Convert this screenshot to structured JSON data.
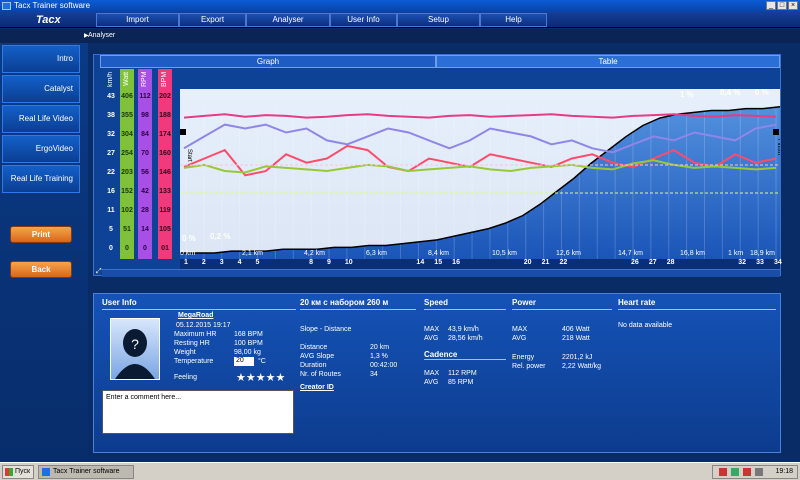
{
  "window": {
    "title": "Tacx Trainer software",
    "min": "_",
    "max": "□",
    "close": "×"
  },
  "menu": {
    "logo": "Tacx",
    "items": [
      "Import",
      "Export",
      "Analyser",
      "User Info",
      "Setup",
      "Help"
    ]
  },
  "breadcrumb": "Analyser",
  "sidebar": {
    "items": [
      "Intro",
      "Catalyst",
      "Real Life Video",
      "ErgoVideo",
      "Real Life Training"
    ],
    "print": "Print",
    "back": "Back"
  },
  "tabs": {
    "graph": "Graph",
    "table": "Table"
  },
  "axes": {
    "headers": [
      "km/h",
      "Watt",
      "RPM",
      "BPM"
    ],
    "kmh": [
      "43",
      "38",
      "32",
      "27",
      "22",
      "16",
      "11",
      "5",
      "0"
    ],
    "watt": [
      "406",
      "355",
      "304",
      "254",
      "203",
      "152",
      "102",
      "51",
      "0"
    ],
    "rpm": [
      "112",
      "98",
      "84",
      "70",
      "56",
      "42",
      "28",
      "14",
      "0"
    ],
    "bpm": [
      "202",
      "188",
      "174",
      "160",
      "146",
      "133",
      "119",
      "105",
      "01"
    ],
    "colors": {
      "kmh": "#0a1e44",
      "watt": "#9ad43b",
      "rpm": "#b55cf0",
      "bpm": "#ff3b7f"
    }
  },
  "chart_data": {
    "type": "line",
    "distance_labels": [
      "0 km",
      "2,1 km",
      "4,2 km",
      "6,3 km",
      "8,4 km",
      "10,5 km",
      "12,6 km",
      "14,7 km",
      "16,8 km",
      "1 km",
      "18,9 km"
    ],
    "segment_numbers": [
      "1",
      "2",
      "3",
      "4",
      "5",
      "8",
      "9",
      "10",
      "14",
      "15",
      "16",
      "20",
      "21",
      "22",
      "26",
      "27",
      "28",
      "32",
      "33",
      "34"
    ],
    "slope_labels": [
      "0 %",
      "0,2 %",
      "1 %",
      "0,4 %",
      "0 %"
    ],
    "start_flag": "Start",
    "finish_flag": "Finish",
    "series": [
      {
        "name": "km/h",
        "color": "#8f86e8",
        "values": [
          28,
          31,
          34,
          33,
          34,
          32,
          33,
          30,
          29,
          31,
          33,
          32,
          30,
          28,
          30,
          33,
          32,
          31,
          29,
          30,
          28,
          27,
          29,
          31,
          30,
          32,
          31,
          30,
          33,
          34
        ]
      },
      {
        "name": "Watt",
        "color": "#ff4b6b",
        "values": [
          220,
          240,
          260,
          200,
          210,
          250,
          230,
          240,
          270,
          260,
          220,
          210,
          240,
          230,
          220,
          250,
          240,
          230,
          220,
          240,
          250,
          230,
          220,
          240,
          260,
          230,
          220,
          250,
          230,
          240
        ]
      },
      {
        "name": "RPM",
        "color": "#98c83a",
        "values": [
          60,
          62,
          58,
          57,
          61,
          60,
          59,
          58,
          60,
          62,
          61,
          58,
          59,
          60,
          61,
          59,
          58,
          60,
          61,
          62,
          60,
          59,
          63,
          65,
          62,
          60,
          61,
          60,
          59,
          60
        ]
      },
      {
        "name": "BPM",
        "color": "#e53c84",
        "values": [
          168,
          170,
          172,
          169,
          171,
          170,
          168,
          169,
          171,
          172,
          170,
          169,
          168,
          170,
          171,
          169,
          170,
          171,
          172,
          170,
          169,
          168,
          170,
          171,
          172,
          170,
          169,
          171,
          170,
          169
        ]
      }
    ],
    "elevation": [
      0,
      0,
      0,
      1,
      1,
      1,
      2,
      2,
      2,
      3,
      3,
      4,
      4,
      5,
      6,
      7,
      9,
      11,
      13,
      16,
      20,
      26,
      33,
      40,
      48,
      55,
      62,
      68,
      72,
      74,
      75,
      76,
      76,
      77,
      77,
      78
    ]
  },
  "userinfo": {
    "title": "User Info",
    "name": "MegaRoad",
    "date": "05.12.2015 19:17",
    "rows": [
      [
        "Maximum HR",
        "168 BPM"
      ],
      [
        "Resting HR",
        "100 BPM"
      ],
      [
        "Weight",
        "98,00 kg"
      ],
      [
        "Temperature",
        "20"
      ]
    ],
    "temp_unit": "°C",
    "feeling": "Feeling",
    "stars": "★★★★★",
    "comment_placeholder": "Enter a comment here..."
  },
  "route": {
    "title": "20 км с набором 260 м",
    "subtitle": "Slope - Distance",
    "rows": [
      [
        "Distance",
        "20 km"
      ],
      [
        "AVG Slope",
        "1,3 %"
      ],
      [
        "Duration",
        "00:42:00"
      ],
      [
        "Nr. of Routes",
        "34"
      ]
    ],
    "creator": "Creator ID"
  },
  "speed": {
    "title": "Speed",
    "rows": [
      [
        "MAX",
        "43,9 km/h"
      ],
      [
        "AVG",
        "28,56 km/h"
      ]
    ]
  },
  "cadence": {
    "title": "Cadence",
    "rows": [
      [
        "MAX",
        "112 RPM"
      ],
      [
        "AVG",
        "85 RPM"
      ]
    ]
  },
  "power": {
    "title": "Power",
    "rows": [
      [
        "MAX",
        "406 Watt"
      ],
      [
        "AVG",
        "218 Watt"
      ]
    ],
    "rows2": [
      [
        "Energy",
        "2201,2 kJ"
      ],
      [
        "Rel. power",
        "2,22 Watt/kg"
      ]
    ]
  },
  "heart": {
    "title": "Heart rate",
    "note": "No data available"
  },
  "taskbar": {
    "start": "Пуск",
    "app": "Tacx Trainer software",
    "time": "19:18"
  }
}
